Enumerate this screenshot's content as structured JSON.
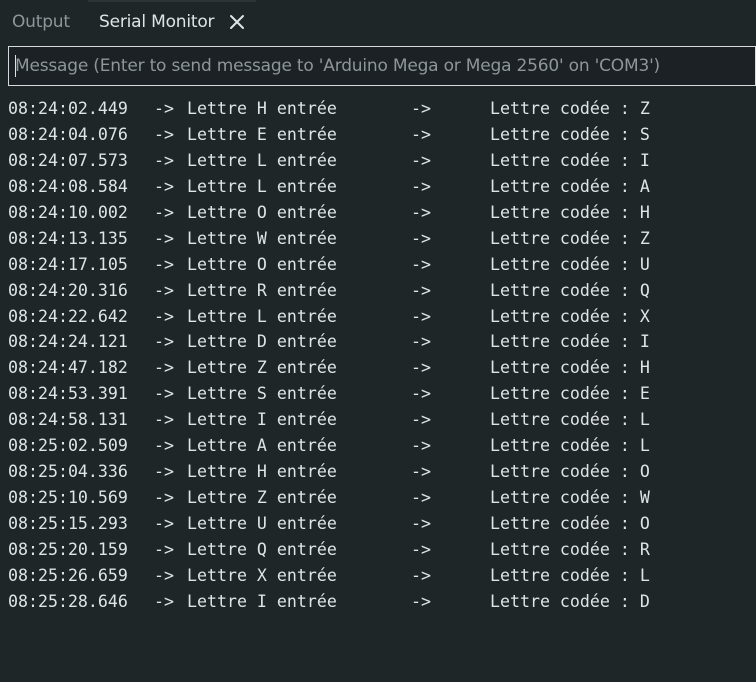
{
  "tabs": {
    "output_label": "Output",
    "serial_monitor_label": "Serial Monitor"
  },
  "message_input": {
    "placeholder": "Message (Enter to send message to 'Arduino Mega or Mega 2560' on 'COM3')",
    "value": ""
  },
  "log": [
    {
      "time": "08:24:02.449",
      "arrow": "->",
      "entry": "Lettre H entrée",
      "arrow2": "->",
      "coded": "Lettre codée : Z"
    },
    {
      "time": "08:24:04.076",
      "arrow": "->",
      "entry": "Lettre E entrée",
      "arrow2": "->",
      "coded": "Lettre codée : S"
    },
    {
      "time": "08:24:07.573",
      "arrow": "->",
      "entry": "Lettre L entrée",
      "arrow2": "->",
      "coded": "Lettre codée : I"
    },
    {
      "time": "08:24:08.584",
      "arrow": "->",
      "entry": "Lettre L entrée",
      "arrow2": "->",
      "coded": "Lettre codée : A"
    },
    {
      "time": "08:24:10.002",
      "arrow": "->",
      "entry": "Lettre O entrée",
      "arrow2": "->",
      "coded": "Lettre codée : H"
    },
    {
      "time": "08:24:13.135",
      "arrow": "->",
      "entry": "Lettre W entrée",
      "arrow2": "->",
      "coded": "Lettre codée : Z"
    },
    {
      "time": "08:24:17.105",
      "arrow": "->",
      "entry": "Lettre O entrée",
      "arrow2": "->",
      "coded": "Lettre codée : U"
    },
    {
      "time": "08:24:20.316",
      "arrow": "->",
      "entry": "Lettre R entrée",
      "arrow2": "->",
      "coded": "Lettre codée : Q"
    },
    {
      "time": "08:24:22.642",
      "arrow": "->",
      "entry": "Lettre L entrée",
      "arrow2": "->",
      "coded": "Lettre codée : X"
    },
    {
      "time": "08:24:24.121",
      "arrow": "->",
      "entry": "Lettre D entrée",
      "arrow2": "->",
      "coded": "Lettre codée : I"
    },
    {
      "time": "08:24:47.182",
      "arrow": "->",
      "entry": "Lettre Z entrée",
      "arrow2": "->",
      "coded": "Lettre codée : H"
    },
    {
      "time": "08:24:53.391",
      "arrow": "->",
      "entry": "Lettre S entrée",
      "arrow2": "->",
      "coded": "Lettre codée : E"
    },
    {
      "time": "08:24:58.131",
      "arrow": "->",
      "entry": "Lettre I entrée",
      "arrow2": "->",
      "coded": "Lettre codée : L"
    },
    {
      "time": "08:25:02.509",
      "arrow": "->",
      "entry": "Lettre A entrée",
      "arrow2": "->",
      "coded": "Lettre codée : L"
    },
    {
      "time": "08:25:04.336",
      "arrow": "->",
      "entry": "Lettre H entrée",
      "arrow2": "->",
      "coded": "Lettre codée : O"
    },
    {
      "time": "08:25:10.569",
      "arrow": "->",
      "entry": "Lettre Z entrée",
      "arrow2": "->",
      "coded": "Lettre codée : W"
    },
    {
      "time": "08:25:15.293",
      "arrow": "->",
      "entry": "Lettre U entrée",
      "arrow2": "->",
      "coded": "Lettre codée : O"
    },
    {
      "time": "08:25:20.159",
      "arrow": "->",
      "entry": "Lettre Q entrée",
      "arrow2": "->",
      "coded": "Lettre codée : R"
    },
    {
      "time": "08:25:26.659",
      "arrow": "->",
      "entry": "Lettre X entrée",
      "arrow2": "->",
      "coded": "Lettre codée : L"
    },
    {
      "time": "08:25:28.646",
      "arrow": "->",
      "entry": "Lettre I entrée",
      "arrow2": "->",
      "coded": "Lettre codée : D"
    }
  ]
}
